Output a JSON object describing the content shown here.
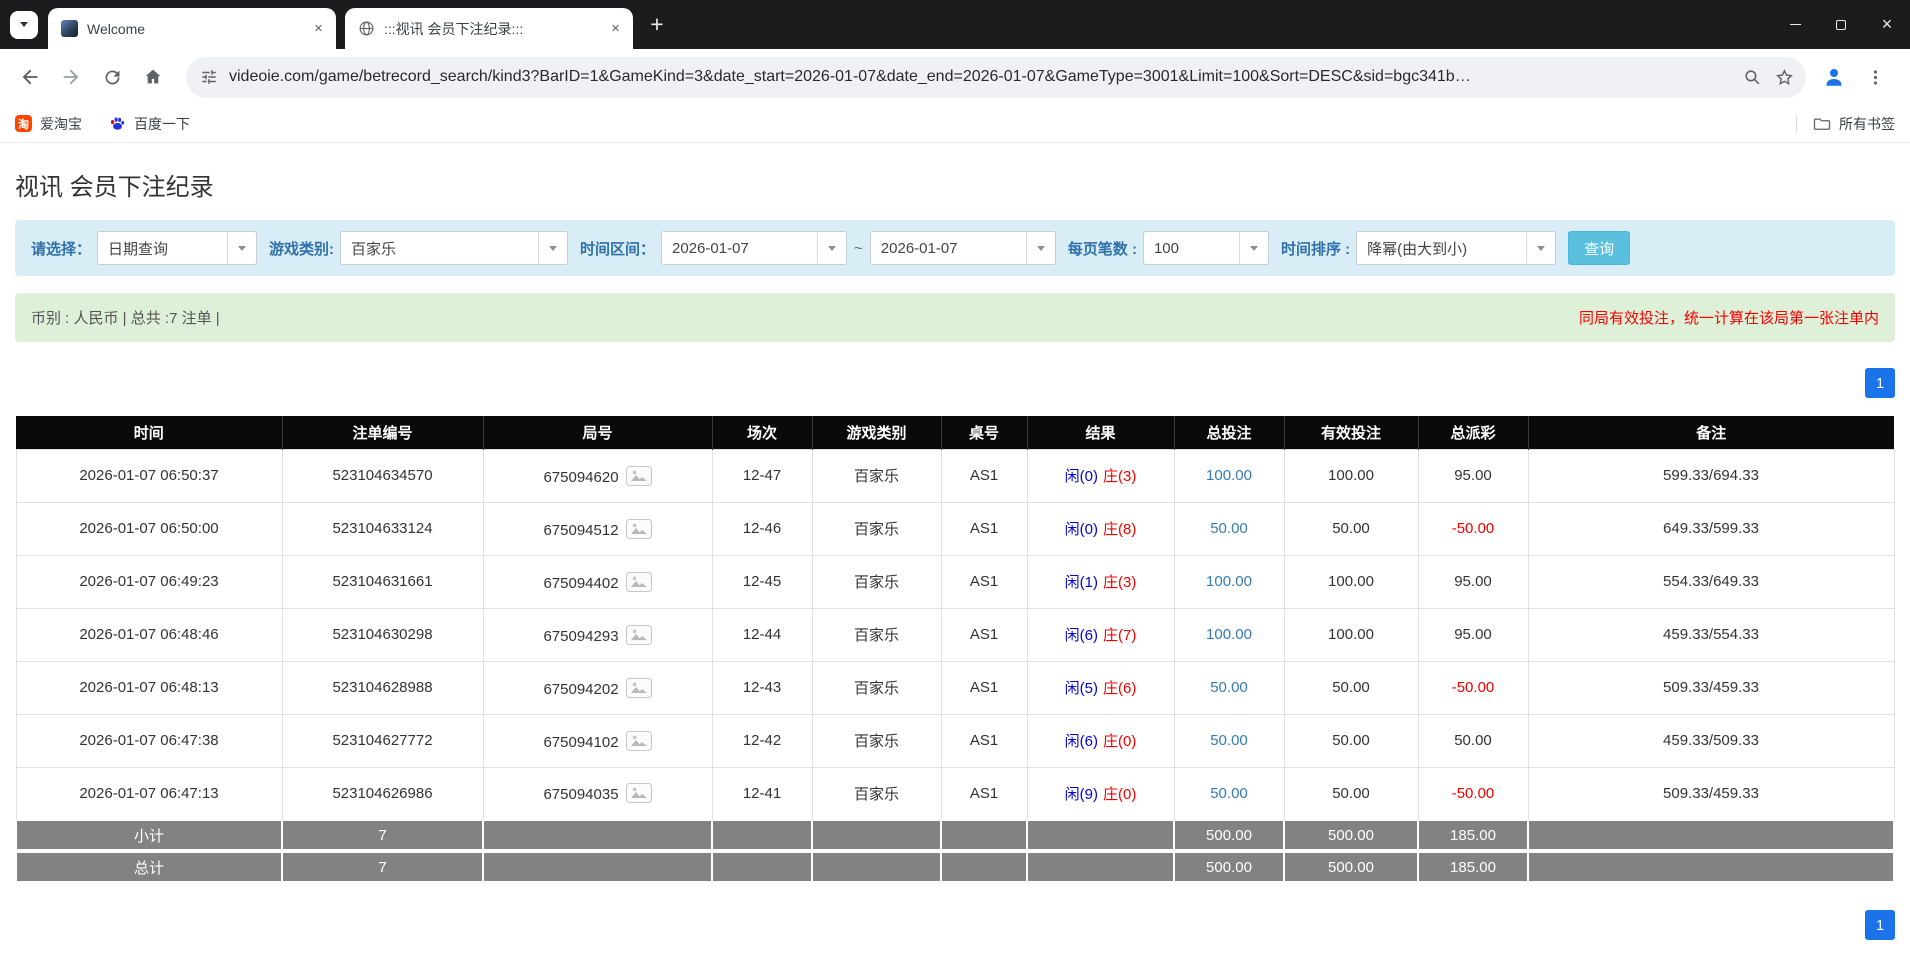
{
  "browser": {
    "tabs": [
      {
        "title": "Welcome"
      },
      {
        "title": ":::视讯 会员下注纪录:::"
      }
    ],
    "url": "videoie.com/game/betrecord_search/kind3?BarID=1&GameKind=3&date_start=2026-01-07&date_end=2026-01-07&GameType=3001&Limit=100&Sort=DESC&sid=bgc341b…",
    "bookmarks": [
      {
        "label": "爱淘宝"
      },
      {
        "label": "百度一下"
      }
    ],
    "all_bookmarks_label": "所有书签"
  },
  "page": {
    "title": "视讯 会员下注纪录",
    "filters": {
      "select_label": "请选择：",
      "select_value": "日期查询",
      "game_label": "游戏类别:",
      "game_value": "百家乐",
      "range_label": "时间区间：",
      "date_start": "2026-01-07",
      "range_separator": "~",
      "date_end": "2026-01-07",
      "per_page_label": "每页笔数 :",
      "per_page_value": "100",
      "sort_label": "时间排序 :",
      "sort_value": "降幂(由大到小)",
      "search_button": "查询"
    },
    "summary": {
      "left": "币别 : 人民币 | 总共 :7 注单 |",
      "right": "同局有效投注，统一计算在该局第一张注单内"
    },
    "pagination": "1",
    "table": {
      "headers": [
        "时间",
        "注单编号",
        "局号",
        "场次",
        "游戏类别",
        "桌号",
        "结果",
        "总投注",
        "有效投注",
        "总派彩",
        "备注"
      ],
      "rows": [
        {
          "time": "2026-01-07 06:50:37",
          "bet_id": "523104634570",
          "round": "675094620",
          "session": "12-47",
          "game": "百家乐",
          "table_no": "AS1",
          "result_player": "闲(0)",
          "result_banker": "庄(3)",
          "total_bet": "100.00",
          "valid_bet": "100.00",
          "payout": "95.00",
          "note": "599.33/694.33"
        },
        {
          "time": "2026-01-07 06:50:00",
          "bet_id": "523104633124",
          "round": "675094512",
          "session": "12-46",
          "game": "百家乐",
          "table_no": "AS1",
          "result_player": "闲(0)",
          "result_banker": "庄(8)",
          "total_bet": "50.00",
          "valid_bet": "50.00",
          "payout": "-50.00",
          "note": "649.33/599.33"
        },
        {
          "time": "2026-01-07 06:49:23",
          "bet_id": "523104631661",
          "round": "675094402",
          "session": "12-45",
          "game": "百家乐",
          "table_no": "AS1",
          "result_player": "闲(1)",
          "result_banker": "庄(3)",
          "total_bet": "100.00",
          "valid_bet": "100.00",
          "payout": "95.00",
          "note": "554.33/649.33"
        },
        {
          "time": "2026-01-07 06:48:46",
          "bet_id": "523104630298",
          "round": "675094293",
          "session": "12-44",
          "game": "百家乐",
          "table_no": "AS1",
          "result_player": "闲(6)",
          "result_banker": "庄(7)",
          "total_bet": "100.00",
          "valid_bet": "100.00",
          "payout": "95.00",
          "note": "459.33/554.33"
        },
        {
          "time": "2026-01-07 06:48:13",
          "bet_id": "523104628988",
          "round": "675094202",
          "session": "12-43",
          "game": "百家乐",
          "table_no": "AS1",
          "result_player": "闲(5)",
          "result_banker": "庄(6)",
          "total_bet": "50.00",
          "valid_bet": "50.00",
          "payout": "-50.00",
          "note": "509.33/459.33"
        },
        {
          "time": "2026-01-07 06:47:38",
          "bet_id": "523104627772",
          "round": "675094102",
          "session": "12-42",
          "game": "百家乐",
          "table_no": "AS1",
          "result_player": "闲(6)",
          "result_banker": "庄(0)",
          "total_bet": "50.00",
          "valid_bet": "50.00",
          "payout": "50.00",
          "note": "459.33/509.33"
        },
        {
          "time": "2026-01-07 06:47:13",
          "bet_id": "523104626986",
          "round": "675094035",
          "session": "12-41",
          "game": "百家乐",
          "table_no": "AS1",
          "result_player": "闲(9)",
          "result_banker": "庄(0)",
          "total_bet": "50.00",
          "valid_bet": "50.00",
          "payout": "-50.00",
          "note": "509.33/459.33"
        }
      ],
      "subtotal": {
        "label": "小计",
        "count": "7",
        "total_bet": "500.00",
        "valid_bet": "500.00",
        "payout": "185.00"
      },
      "total": {
        "label": "总计",
        "count": "7",
        "total_bet": "500.00",
        "valid_bet": "500.00",
        "payout": "185.00"
      }
    }
  }
}
